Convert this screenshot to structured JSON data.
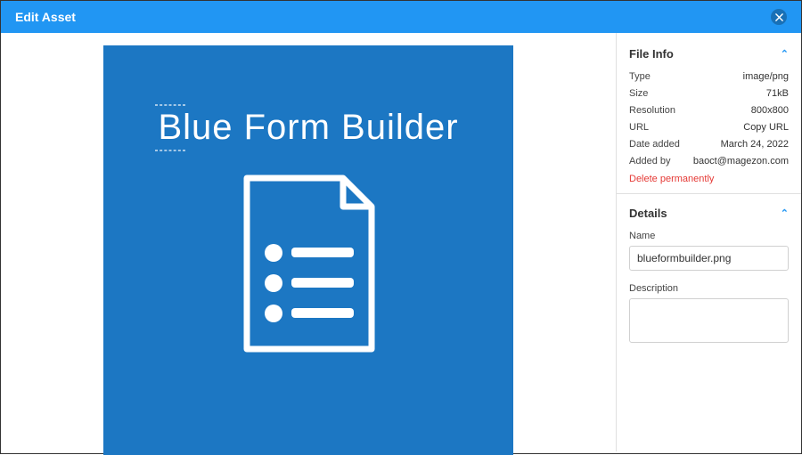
{
  "header": {
    "title": "Edit Asset"
  },
  "preview": {
    "title": "Blue Form Builder"
  },
  "fileInfo": {
    "heading": "File Info",
    "rows": {
      "type": {
        "label": "Type",
        "value": "image/png"
      },
      "size": {
        "label": "Size",
        "value": "71kB"
      },
      "resolution": {
        "label": "Resolution",
        "value": "800x800"
      },
      "url": {
        "label": "URL",
        "value": "Copy URL"
      },
      "dateAdded": {
        "label": "Date added",
        "value": "March 24, 2022"
      },
      "addedBy": {
        "label": "Added by",
        "value": "baoct@magezon.com"
      }
    },
    "delete": "Delete permanently"
  },
  "details": {
    "heading": "Details",
    "nameLabel": "Name",
    "nameValue": "blueformbuilder.png",
    "descLabel": "Description",
    "descValue": ""
  }
}
